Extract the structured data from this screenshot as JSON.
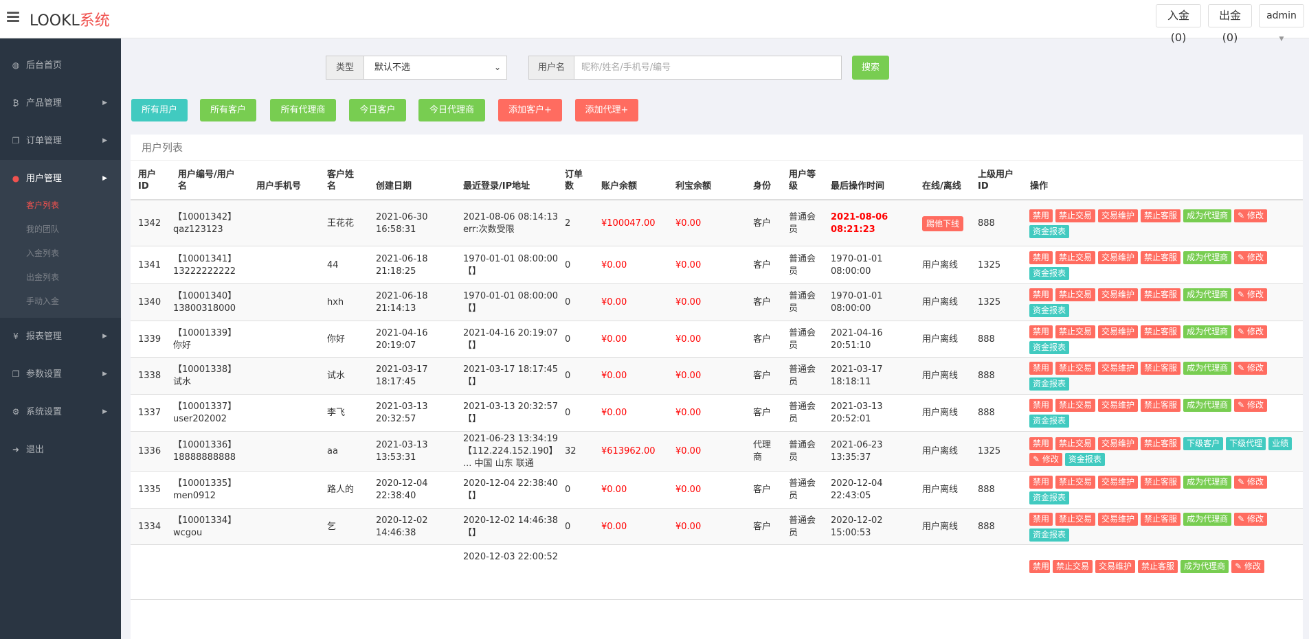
{
  "header": {
    "logo_main": "LOOKL",
    "logo_accent": "系统",
    "deposit_label": "入金(0)",
    "withdraw_label": "出金(0)",
    "admin_label": "admin"
  },
  "sidebar": {
    "items": [
      {
        "label": "后台首页",
        "icon": "dashboard-icon"
      },
      {
        "label": "产品管理",
        "icon": "bitcoin-icon"
      },
      {
        "label": "订单管理",
        "icon": "copy-icon"
      },
      {
        "label": "用户管理",
        "icon": "user-icon"
      },
      {
        "label": "报表管理",
        "icon": "yen-icon"
      },
      {
        "label": "参数设置",
        "icon": "copy-icon"
      },
      {
        "label": "系统设置",
        "icon": "cogs-icon"
      },
      {
        "label": "退出",
        "icon": "signout-icon"
      }
    ],
    "submenu": [
      "客户列表",
      "我的团队",
      "入金列表",
      "出金列表",
      "手动入金"
    ]
  },
  "search": {
    "type_label": "类型",
    "type_value": "默认不选",
    "user_label": "用户名",
    "user_placeholder": "昵称/姓名/手机号/编号",
    "search_button": "搜索"
  },
  "filters": [
    "所有用户",
    "所有客户",
    "所有代理商",
    "今日客户",
    "今日代理商",
    "添加客户+",
    "添加代理+"
  ],
  "panel_title": "用户列表",
  "table": {
    "headers": {
      "id": [
        "用户",
        "ID"
      ],
      "code": [
        "用户编号/用户",
        "名"
      ],
      "phone": "用户手机号",
      "name": [
        "客户姓",
        "名"
      ],
      "created": "创建日期",
      "login": "最近登录/IP地址",
      "orders": [
        "订单",
        "数"
      ],
      "balance": "账户余额",
      "profit": "利宝余额",
      "role": "身份",
      "level": [
        "用户等",
        "级"
      ],
      "lastop": "最后操作时间",
      "online": "在线/离线",
      "parent": [
        "上级用户",
        "ID"
      ],
      "ops": "操作"
    },
    "op_labels": {
      "ban": "禁用",
      "no_trade": "禁止交易",
      "maintain": "交易维护",
      "no_service": "禁止客服",
      "to_agent": "成为代理商",
      "edit": "✎ 修改",
      "report": "资金报表",
      "sub_client": "下级客户",
      "sub_agent": "下级代理",
      "perf": "业绩"
    },
    "rows": [
      {
        "id": "1342",
        "code": "【10001342】",
        "uname": "qaz123123",
        "name": "王花花",
        "created": [
          "2021-06-30",
          "16:58:31"
        ],
        "login": [
          "2021-08-06 08:14:13",
          "err:次数受限"
        ],
        "orders": "2",
        "balance": "¥100047.00",
        "profit": "¥0.00",
        "role": "客户",
        "level": [
          "普通会",
          "员"
        ],
        "lastop": [
          "2021-08-06",
          "08:21:23"
        ],
        "online": "踢他下线",
        "parent": "888"
      },
      {
        "id": "1341",
        "code": "【10001341】",
        "uname": "13222222222",
        "name": "44",
        "created": [
          "2021-06-18",
          "21:18:25"
        ],
        "login": [
          "1970-01-01 08:00:00",
          "【】"
        ],
        "orders": "0",
        "balance": "¥0.00",
        "profit": "¥0.00",
        "role": "客户",
        "level": [
          "普通会",
          "员"
        ],
        "lastop": [
          "1970-01-01",
          "08:00:00"
        ],
        "online": "用户离线",
        "parent": "1325"
      },
      {
        "id": "1340",
        "code": "【10001340】",
        "uname": "13800318000",
        "name": "hxh",
        "created": [
          "2021-06-18",
          "21:14:13"
        ],
        "login": [
          "1970-01-01 08:00:00",
          "【】"
        ],
        "orders": "0",
        "balance": "¥0.00",
        "profit": "¥0.00",
        "role": "客户",
        "level": [
          "普通会",
          "员"
        ],
        "lastop": [
          "1970-01-01",
          "08:00:00"
        ],
        "online": "用户离线",
        "parent": "1325"
      },
      {
        "id": "1339",
        "code": "【10001339】",
        "uname": "你好",
        "name": "你好",
        "created": [
          "2021-04-16",
          "20:19:07"
        ],
        "login": [
          "2021-04-16 20:19:07",
          "【】"
        ],
        "orders": "0",
        "balance": "¥0.00",
        "profit": "¥0.00",
        "role": "客户",
        "level": [
          "普通会",
          "员"
        ],
        "lastop": [
          "2021-04-16",
          "20:51:10"
        ],
        "online": "用户离线",
        "parent": "888"
      },
      {
        "id": "1338",
        "code": "【10001338】",
        "uname": "试水",
        "name": "试水",
        "created": [
          "2021-03-17",
          "18:17:45"
        ],
        "login": [
          "2021-03-17 18:17:45",
          "【】"
        ],
        "orders": "0",
        "balance": "¥0.00",
        "profit": "¥0.00",
        "role": "客户",
        "level": [
          "普通会",
          "员"
        ],
        "lastop": [
          "2021-03-17",
          "18:18:11"
        ],
        "online": "用户离线",
        "parent": "888"
      },
      {
        "id": "1337",
        "code": "【10001337】",
        "uname": "user202002",
        "name": "李飞",
        "created": [
          "2021-03-13",
          "20:32:57"
        ],
        "login": [
          "2021-03-13 20:32:57",
          "【】"
        ],
        "orders": "0",
        "balance": "¥0.00",
        "profit": "¥0.00",
        "role": "客户",
        "level": [
          "普通会",
          "员"
        ],
        "lastop": [
          "2021-03-13",
          "20:52:01"
        ],
        "online": "用户离线",
        "parent": "888"
      },
      {
        "id": "1336",
        "code": "【10001336】",
        "uname": "18888888888",
        "name": "aa",
        "created": [
          "2021-03-13",
          "13:53:31"
        ],
        "login": [
          "2021-06-23 13:34:19",
          "【112.224.152.190】",
          "... 中国 山东 联通"
        ],
        "orders": "32",
        "balance": "¥613962.00",
        "profit": "¥0.00",
        "role": "代理",
        "role2": "商",
        "level": [
          "普通会",
          "员"
        ],
        "lastop": [
          "2021-06-23",
          "13:35:37"
        ],
        "online": "用户离线",
        "parent": "1325"
      },
      {
        "id": "1335",
        "code": "【10001335】",
        "uname": "men0912",
        "name": "路人的",
        "created": [
          "2020-12-04",
          "22:38:40"
        ],
        "login": [
          "2020-12-04 22:38:40",
          "【】"
        ],
        "orders": "0",
        "balance": "¥0.00",
        "profit": "¥0.00",
        "role": "客户",
        "level": [
          "普通会",
          "员"
        ],
        "lastop": [
          "2020-12-04",
          "22:43:05"
        ],
        "online": "用户离线",
        "parent": "888"
      },
      {
        "id": "1334",
        "code": "【10001334】",
        "uname": "wcgou",
        "name": "乞",
        "created": [
          "2020-12-02",
          "14:46:38"
        ],
        "login": [
          "2020-12-02 14:46:38",
          "【】"
        ],
        "orders": "0",
        "balance": "¥0.00",
        "profit": "¥0.00",
        "role": "客户",
        "level": [
          "普通会",
          "员"
        ],
        "lastop": [
          "2020-12-02",
          "15:00:53"
        ],
        "online": "用户离线",
        "parent": "888"
      },
      {
        "login": [
          "2020-12-03 22:00:52"
        ]
      }
    ]
  }
}
